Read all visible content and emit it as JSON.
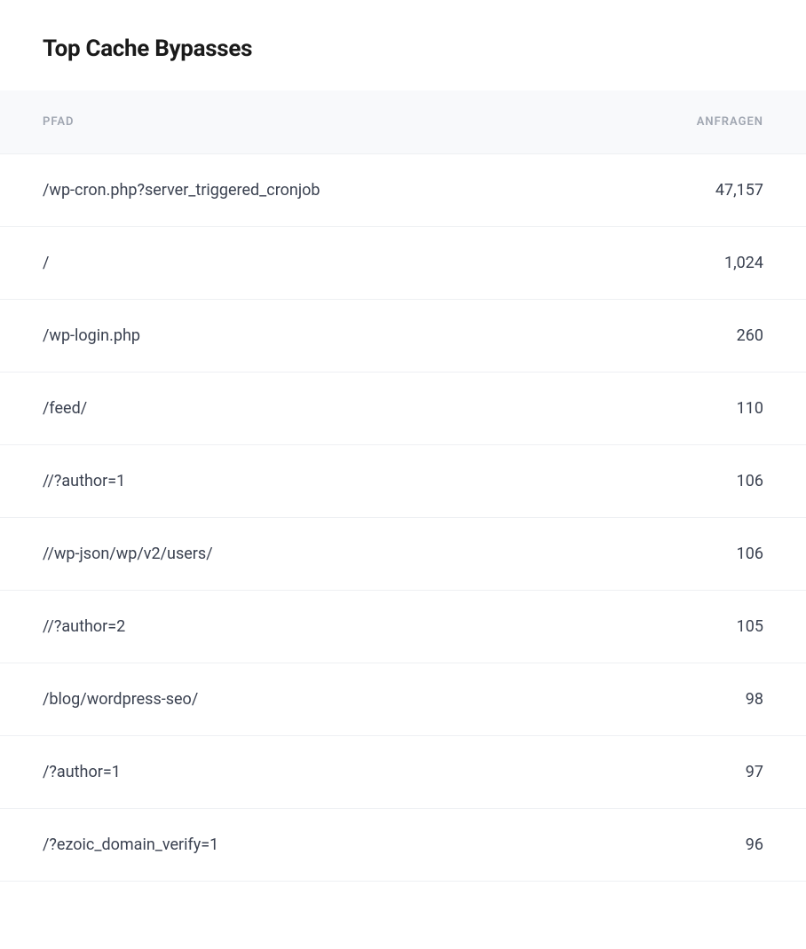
{
  "title": "Top Cache Bypasses",
  "columns": {
    "path": "PFAD",
    "requests": "ANFRAGEN"
  },
  "rows": [
    {
      "path": "/wp-cron.php?server_triggered_cronjob",
      "requests": "47,157"
    },
    {
      "path": "/",
      "requests": "1,024"
    },
    {
      "path": "/wp-login.php",
      "requests": "260"
    },
    {
      "path": "/feed/",
      "requests": "110"
    },
    {
      "path": "//?author=1",
      "requests": "106"
    },
    {
      "path": "//wp-json/wp/v2/users/",
      "requests": "106"
    },
    {
      "path": "//?author=2",
      "requests": "105"
    },
    {
      "path": "/blog/wordpress-seo/",
      "requests": "98"
    },
    {
      "path": "/?author=1",
      "requests": "97"
    },
    {
      "path": "/?ezoic_domain_verify=1",
      "requests": "96"
    }
  ]
}
